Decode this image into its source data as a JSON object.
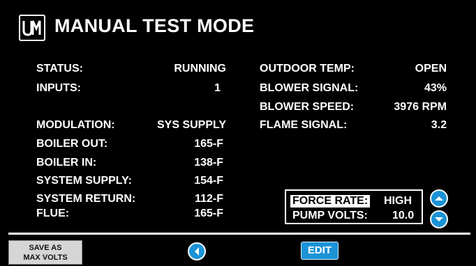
{
  "header": {
    "title": "MANUAL TEST MODE",
    "logo_text": "UM"
  },
  "left_fields": [
    {
      "label": "STATUS:",
      "value": "RUNNING"
    },
    {
      "label": "INPUTS:",
      "value": "1"
    },
    {
      "label": "MODULATION:",
      "value": "SYS SUPPLY"
    },
    {
      "label": "BOILER OUT:",
      "value": "165-F"
    },
    {
      "label": "BOILER IN:",
      "value": "138-F"
    },
    {
      "label": "SYSTEM SUPPLY:",
      "value": "154-F"
    },
    {
      "label": "SYSTEM RETURN:",
      "value": "112-F"
    },
    {
      "label": "FLUE:",
      "value": "165-F"
    }
  ],
  "right_fields": [
    {
      "label": "OUTDOOR TEMP:",
      "value": "OPEN"
    },
    {
      "label": "BLOWER SIGNAL:",
      "value": "43%"
    },
    {
      "label": "BLOWER SPEED:",
      "value": "3976 RPM"
    },
    {
      "label": "FLAME SIGNAL:",
      "value": "3.2"
    }
  ],
  "force_panel": {
    "force_rate_label": "FORCE RATE:",
    "force_rate_value": "HIGH",
    "pump_volts_label": "PUMP VOLTS:",
    "pump_volts_value": "10.0"
  },
  "footer": {
    "save_line1": "SAVE AS",
    "save_line2": "MAX VOLTS",
    "edit_label": "EDIT"
  },
  "colors": {
    "background": "#000000",
    "text": "#ffffff",
    "accent": "#1b93d6"
  },
  "icons": [
    "logo-icon",
    "arrow-up-icon",
    "arrow-down-icon",
    "arrow-left-icon"
  ]
}
